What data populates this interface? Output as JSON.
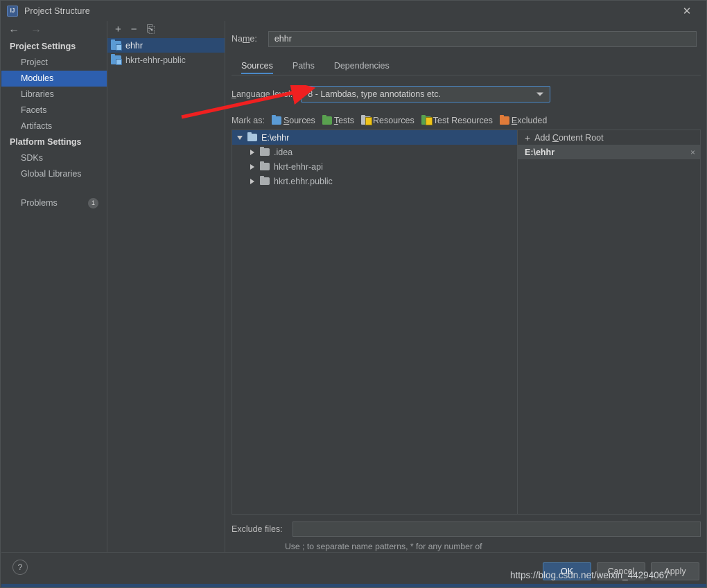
{
  "window": {
    "title": "Project Structure",
    "app_icon": "intellij-idea-icon",
    "close_label": "✕"
  },
  "nav": {
    "back": "←",
    "forward": "→"
  },
  "sidebar": {
    "groups": [
      {
        "label": "Project Settings",
        "items": [
          {
            "label": "Project",
            "selected": false
          },
          {
            "label": "Modules",
            "selected": true
          },
          {
            "label": "Libraries",
            "selected": false
          },
          {
            "label": "Facets",
            "selected": false
          },
          {
            "label": "Artifacts",
            "selected": false
          }
        ]
      },
      {
        "label": "Platform Settings",
        "items": [
          {
            "label": "SDKs",
            "selected": false
          },
          {
            "label": "Global Libraries",
            "selected": false
          }
        ]
      }
    ],
    "problems": {
      "label": "Problems",
      "count": "1"
    }
  },
  "modules_panel": {
    "toolbar": {
      "add": "+",
      "remove": "−",
      "copy": "⎘"
    },
    "items": [
      {
        "label": "ehhr",
        "selected": true
      },
      {
        "label": "hkrt-ehhr-public",
        "selected": false
      }
    ]
  },
  "main": {
    "name_label": "Name:",
    "name_value": "ehhr",
    "tabs": [
      {
        "label": "Sources",
        "active": true
      },
      {
        "label": "Paths",
        "active": false
      },
      {
        "label": "Dependencies",
        "active": false
      }
    ],
    "language_level_label": "Language level:",
    "language_level_value": "8 - Lambdas, type annotations etc.",
    "mark_as_label": "Mark as:",
    "mark_as": [
      {
        "label": "Sources",
        "color": "#5b9bd5"
      },
      {
        "label": "Tests",
        "color": "#59a14f"
      },
      {
        "label": "Resources",
        "color": "#b8bcbe"
      },
      {
        "label": "Test Resources",
        "color": "#59a14f"
      },
      {
        "label": "Excluded",
        "color": "#e07b39"
      }
    ],
    "tree": [
      {
        "label": "E:\\ehhr",
        "depth": 0,
        "state": "expanded",
        "selected": true
      },
      {
        "label": ".idea",
        "depth": 1,
        "state": "collapsed",
        "selected": false
      },
      {
        "label": "hkrt-ehhr-api",
        "depth": 1,
        "state": "collapsed",
        "selected": false
      },
      {
        "label": "hkrt.ehhr.public",
        "depth": 1,
        "state": "collapsed",
        "selected": false
      }
    ],
    "content_roots": {
      "add_label": "Add Content Root",
      "items": [
        {
          "label": "E:\\ehhr",
          "remove": "×"
        }
      ]
    },
    "exclude_label": "Exclude files:",
    "exclude_value": "",
    "exclude_hint": "Use ; to separate name patterns, * for any number of symbols, ? for one."
  },
  "footer": {
    "help": "?",
    "buttons": [
      {
        "label": "OK",
        "primary": true
      },
      {
        "label": "Cancel",
        "primary": false
      },
      {
        "label": "Apply",
        "primary": false
      }
    ]
  },
  "watermark": "https://blog.csdn.net/weixin_44294067",
  "colors": {
    "background": "#3c3f41",
    "selection_blue": "#2d5faf",
    "tree_selection": "#2b4a72",
    "accent": "#4a88c7",
    "arrow_red": "#f02020"
  }
}
